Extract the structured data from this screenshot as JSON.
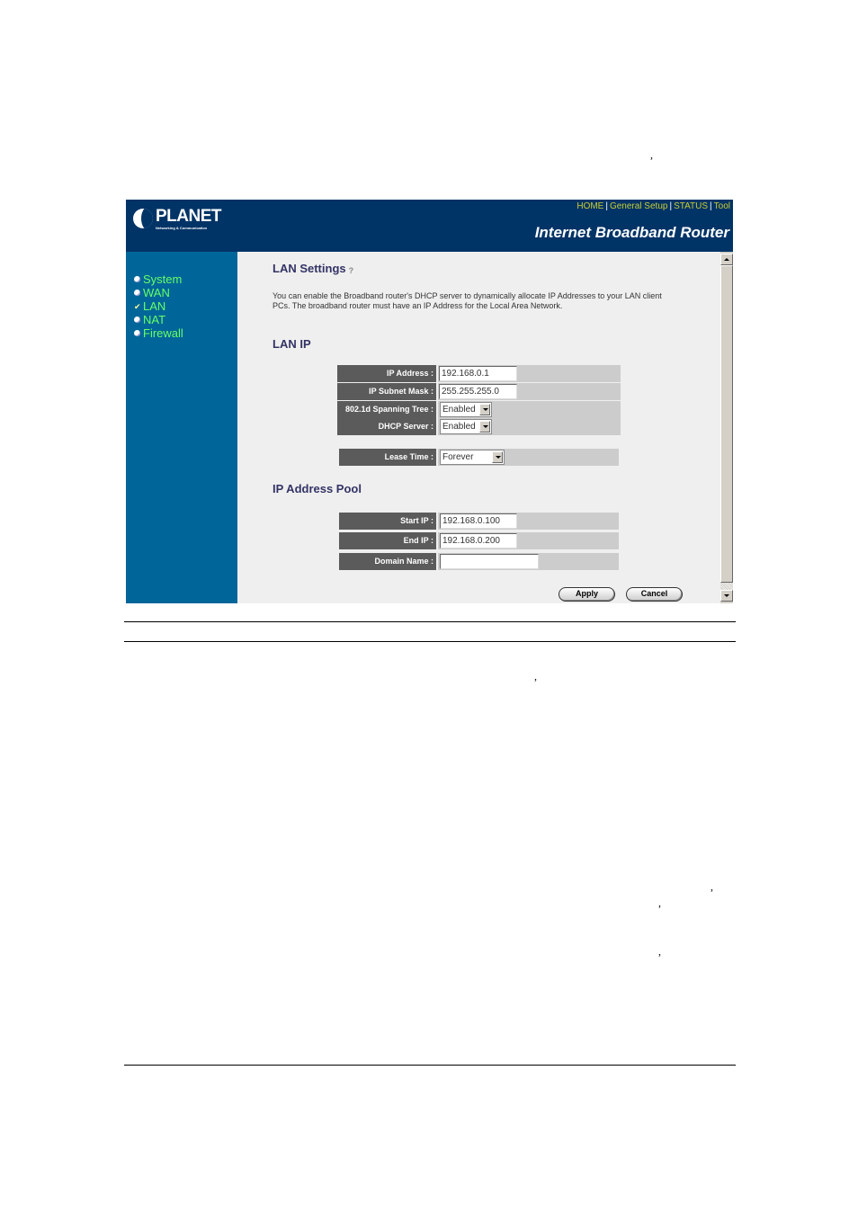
{
  "page": {
    "stray_marks": [
      ",",
      ",",
      ",",
      ",",
      ","
    ]
  },
  "router": {
    "logo": {
      "name": "PLANET",
      "tagline": "Networking & Communication"
    },
    "top_nav": [
      {
        "label": "HOME"
      },
      {
        "label": "General Setup"
      },
      {
        "label": "STATUS"
      },
      {
        "label": "Tool"
      }
    ],
    "nav_separator": "|",
    "product_title": "Internet Broadband Router",
    "colors": {
      "header": "#003366",
      "sidebar": "#006699",
      "nav_link": "#cccc33",
      "sidebar_text": "#66ff66",
      "label_bg": "#5b5b5b"
    },
    "sidebar": {
      "items": [
        {
          "label": "System",
          "icon": "bullet-icon",
          "active": false
        },
        {
          "label": "WAN",
          "icon": "bullet-icon",
          "active": false
        },
        {
          "label": "LAN",
          "icon": "check-icon",
          "active": true
        },
        {
          "label": "NAT",
          "icon": "bullet-icon",
          "active": false
        },
        {
          "label": "Firewall",
          "icon": "bullet-icon",
          "active": false
        }
      ]
    },
    "content": {
      "title": "LAN Settings",
      "help_icon": "help-icon",
      "description": "You can enable the Broadband router's DHCP server to dynamically allocate IP Addresses to your LAN client PCs. The broadband router must have an IP Address for the Local Area Network.",
      "lan_ip": {
        "heading": "LAN IP",
        "ip_address": {
          "label": "IP Address :",
          "value": "192.168.0.1"
        },
        "subnet_mask": {
          "label": "IP Subnet Mask :",
          "value": "255.255.255.0"
        },
        "spanning_tree": {
          "label": "802.1d Spanning Tree :",
          "value": "Enabled"
        },
        "dhcp_server": {
          "label": "DHCP Server :",
          "value": "Enabled"
        },
        "lease_time": {
          "label": "Lease Time :",
          "value": "Forever"
        }
      },
      "pool": {
        "heading": "IP Address Pool",
        "start_ip": {
          "label": "Start IP :",
          "value": "192.168.0.100"
        },
        "end_ip": {
          "label": "End IP :",
          "value": "192.168.0.200"
        },
        "domain_name": {
          "label": "Domain Name :",
          "value": ""
        }
      },
      "buttons": {
        "apply": "Apply",
        "cancel": "Cancel"
      }
    }
  }
}
